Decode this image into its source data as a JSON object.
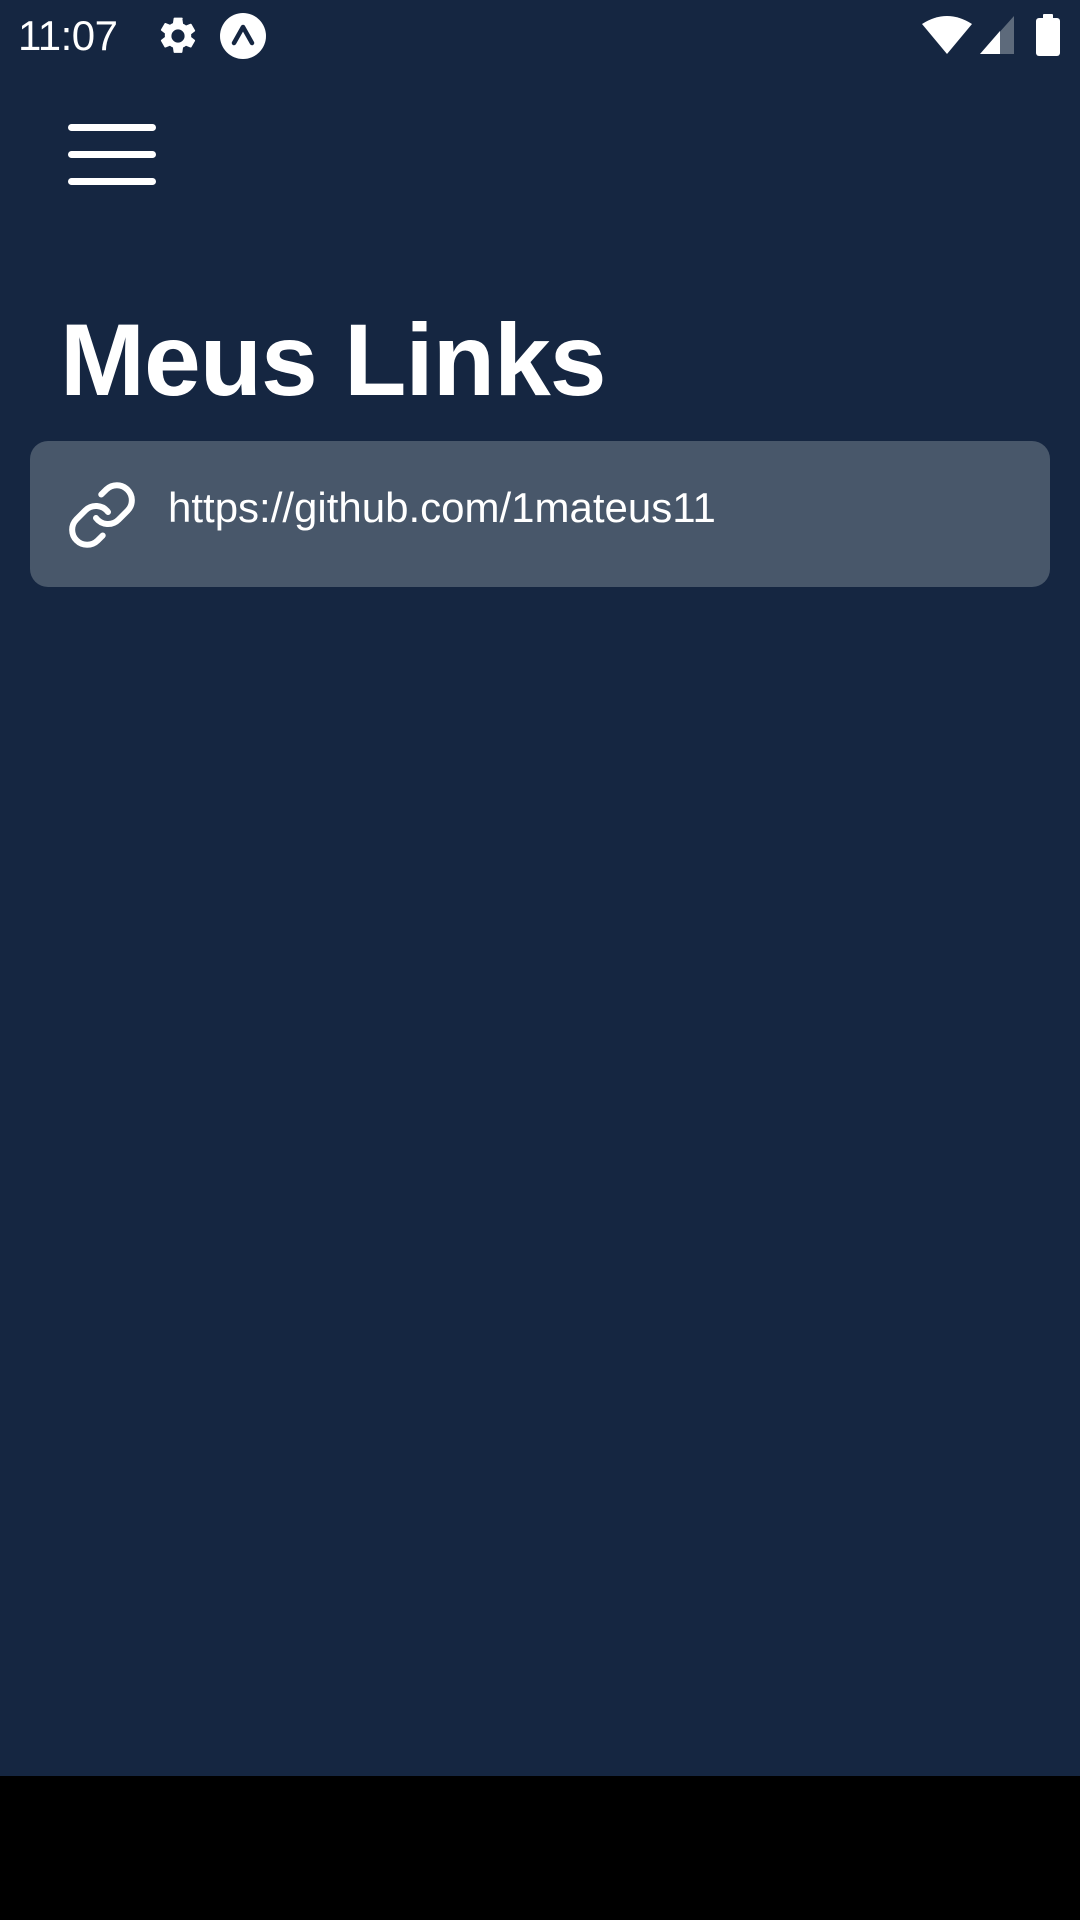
{
  "status_bar": {
    "time": "11:07",
    "icons": [
      "gear-icon",
      "expo-icon",
      "wifi-icon",
      "signal-icon",
      "battery-icon"
    ]
  },
  "header": {
    "menu_icon": "hamburger-menu-icon"
  },
  "main": {
    "title": "Meus Links",
    "links": [
      {
        "icon": "link-icon",
        "url": "https://github.com/1mateus11"
      }
    ]
  },
  "colors": {
    "background": "#152641",
    "card": "#48576a",
    "text": "#ffffff",
    "nav_bar": "#000000"
  }
}
